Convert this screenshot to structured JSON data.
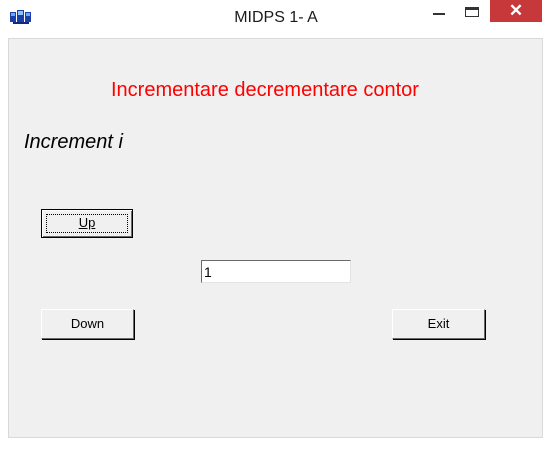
{
  "window": {
    "title": "MIDPS 1- A",
    "app_icon": "app-window-icon",
    "controls": {
      "minimize_icon": "minimize-icon",
      "maximize_icon": "maximize-icon",
      "close_glyph": "✕",
      "close_color": "#c7383b"
    }
  },
  "form": {
    "heading": "Incrementare decrementare contor",
    "heading_color": "#ff0000",
    "subheading": "Increment i",
    "up_button": "Up",
    "counter_value": "1",
    "down_button": "Down",
    "exit_button": "Exit"
  }
}
